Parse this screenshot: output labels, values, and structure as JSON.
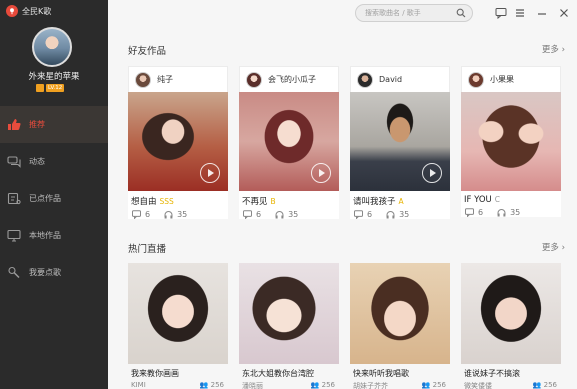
{
  "app": {
    "title": "全民K歌"
  },
  "profile": {
    "username": "外来星的苹果",
    "level": "LV.12"
  },
  "nav": [
    {
      "label": "推荐",
      "icon": "thumbs-up-icon",
      "active": true
    },
    {
      "label": "动态",
      "icon": "chat-bubbles-icon",
      "active": false
    },
    {
      "label": "已点作品",
      "icon": "song-list-icon",
      "active": false
    },
    {
      "label": "本地作品",
      "icon": "monitor-icon",
      "active": false
    },
    {
      "label": "我要点歌",
      "icon": "microphone-icon",
      "active": false
    }
  ],
  "search": {
    "placeholder": "搜索歌曲名 / 歌手"
  },
  "friends": {
    "title": "好友作品",
    "more": "更多 ›",
    "cards": [
      {
        "user": "纯子",
        "song": "想自由",
        "grade": "SSS",
        "grade_color": "#e8b400",
        "comments": "6",
        "listens": "35"
      },
      {
        "user": "会飞的小瓜子",
        "song": "不再见",
        "grade": "B",
        "grade_color": "#e8b400",
        "comments": "6",
        "listens": "35"
      },
      {
        "user": "David",
        "song": "请叫我孩子",
        "grade": "A",
        "grade_color": "#e8b400",
        "comments": "6",
        "listens": "35"
      },
      {
        "user": "小果果",
        "song": "IF YOU",
        "grade": "C",
        "grade_color": "#999999",
        "comments": "6",
        "listens": "35"
      }
    ]
  },
  "live": {
    "title": "热门直播",
    "more": "更多 ›",
    "items": [
      {
        "title": "我来教你画画",
        "host": "KIMI",
        "viewers": "256"
      },
      {
        "title": "东北大姐教你台湾腔",
        "host": "潘晓丽",
        "viewers": "256"
      },
      {
        "title": "快来听听我唱歌",
        "host": "胡妹子芥芥",
        "viewers": "256"
      },
      {
        "title": "谁说妹子不搞滚",
        "host": "微笑偻偻",
        "viewers": "256"
      }
    ]
  },
  "colors": {
    "accent": "#e84c3d",
    "sidebar": "#2b2b2b",
    "content": "#f6f6f6"
  }
}
